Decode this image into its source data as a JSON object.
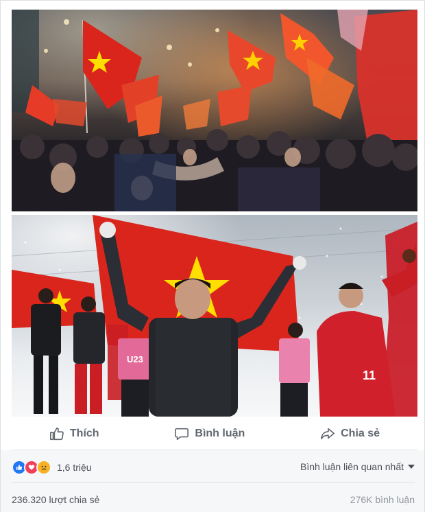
{
  "post": {
    "photos": [
      {
        "alt_icon": "photo-crowd-flags"
      },
      {
        "alt_icon": "photo-players-snow"
      }
    ],
    "banner_text": "U23",
    "jersey_number": "11"
  },
  "actions": {
    "like_label": "Thích",
    "comment_label": "Bình luận",
    "share_label": "Chia sẻ"
  },
  "summary": {
    "reaction_icons": [
      "like-icon",
      "love-icon",
      "sad-icon"
    ],
    "reaction_count": "1,6 triệu",
    "sort_label": "Bình luận liên quan nhất",
    "shares_text": "236.320 lượt chia sẻ",
    "comments_text": "276K bình luận"
  },
  "colors": {
    "flag_red": "#da251d",
    "flag_yellow": "#ffde00",
    "like_blue": "#2078f4",
    "love_red": "#f33e58",
    "sad_yellow": "#f7b125"
  }
}
